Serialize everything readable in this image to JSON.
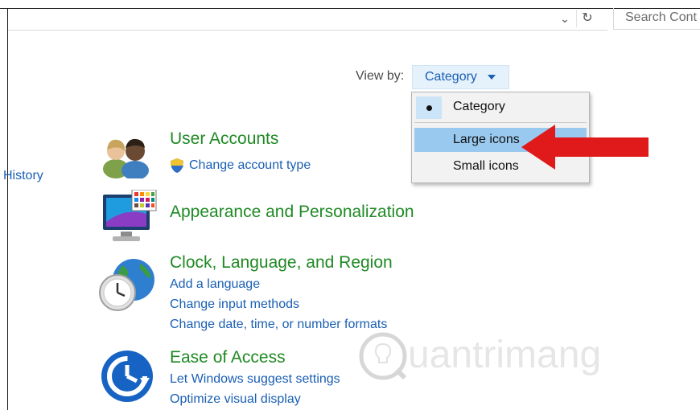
{
  "toolbar": {
    "search_placeholder": "Search Cont",
    "refresh_icon": "refresh-icon",
    "dropdown_icon": "chevron-down-icon"
  },
  "sidebar": {
    "history_label": "History"
  },
  "viewby": {
    "label": "View by:",
    "value": "Category",
    "menu": {
      "items": [
        "Category",
        "Large icons",
        "Small icons"
      ],
      "selected": "Category",
      "highlighted": "Large icons"
    }
  },
  "categories": [
    {
      "title": "User Accounts",
      "icon": "users-icon",
      "links": [
        "Change account type"
      ]
    },
    {
      "title": "Appearance and Personalization",
      "icon": "monitor-icon",
      "links": []
    },
    {
      "title": "Clock, Language, and Region",
      "icon": "clock-globe-icon",
      "links": [
        "Add a language",
        "Change input methods",
        "Change date, time, or number formats"
      ]
    },
    {
      "title": "Ease of Access",
      "icon": "ease-of-access-icon",
      "links": [
        "Let Windows suggest settings",
        "Optimize visual display"
      ]
    }
  ],
  "watermark": "uantrimang",
  "colors": {
    "link": "#1a5fb4",
    "category": "#1f8a24",
    "highlight": "#99c9ef",
    "arrow": "#e01a1a"
  }
}
